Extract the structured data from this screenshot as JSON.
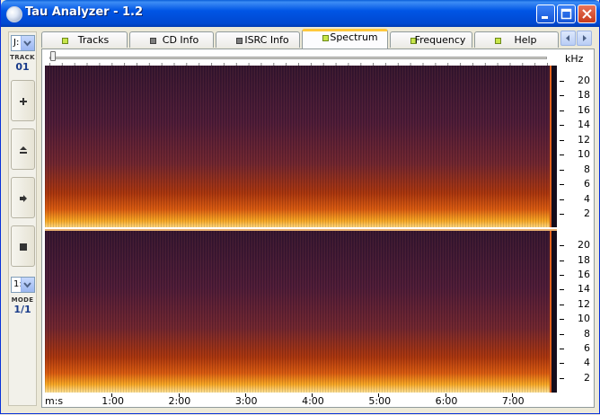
{
  "window": {
    "title": "Tau Analyzer - 1.2"
  },
  "left_panel": {
    "drive_value": "J:",
    "track_label": "TRACK",
    "track_value": "01",
    "mode_select_value": "1:",
    "mode_label": "MODE",
    "mode_value": "1/1"
  },
  "tabs": [
    {
      "label": "Tracks",
      "led": "green"
    },
    {
      "label": "CD Info",
      "led": "gray"
    },
    {
      "label": "ISRC Info",
      "led": "gray"
    },
    {
      "label": "Spectrum",
      "led": "green",
      "active": true
    },
    {
      "label": "Frequency",
      "led": "green"
    },
    {
      "label": "Help",
      "led": "green"
    }
  ],
  "spectrum": {
    "y_unit": "kHz",
    "y_ticks": [
      "20",
      "18",
      "16",
      "14",
      "12",
      "10",
      "8",
      "6",
      "4",
      "2"
    ],
    "x_unit": "m:s",
    "x_ticks": [
      "1:00",
      "2:00",
      "3:00",
      "4:00",
      "5:00",
      "6:00",
      "7:00"
    ],
    "colors": {
      "dark": "#3a1838",
      "mid": "#a8340e",
      "bright": "#f7a824",
      "peak": "#fde39a"
    }
  }
}
